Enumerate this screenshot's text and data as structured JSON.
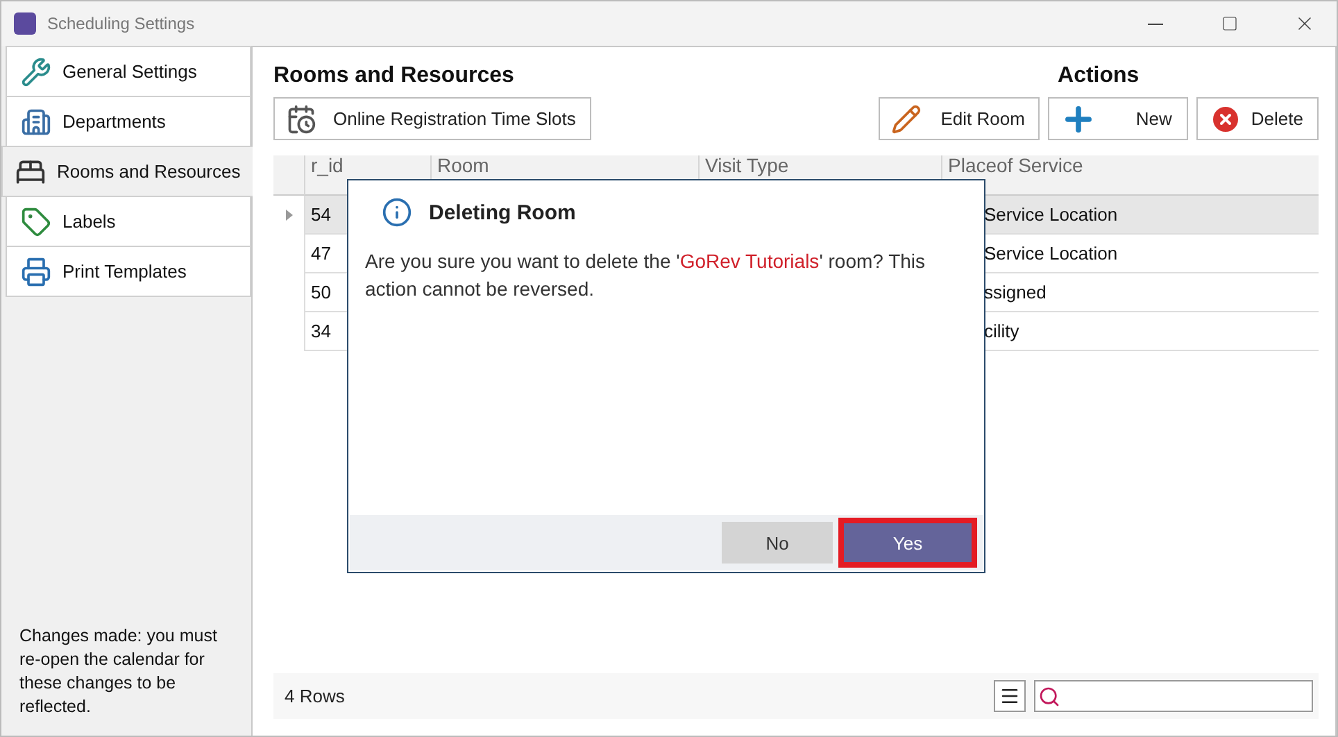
{
  "window": {
    "title": "Scheduling Settings"
  },
  "sidebar": {
    "items": [
      {
        "label": "General Settings",
        "selected": false
      },
      {
        "label": "Departments",
        "selected": false
      },
      {
        "label": "Rooms and Resources",
        "selected": true
      },
      {
        "label": "Labels",
        "selected": false
      },
      {
        "label": "Print Templates",
        "selected": false
      }
    ],
    "note": "Changes made: you must re-open the calendar for these changes to be reflected."
  },
  "section": {
    "title": "Rooms and Resources",
    "toolbar_button": "Online Registration Time Slots"
  },
  "actions": {
    "title": "Actions",
    "buttons": [
      {
        "label": "Edit Room",
        "kind": "edit"
      },
      {
        "label": "New",
        "kind": "new"
      },
      {
        "label": "Delete",
        "kind": "delete"
      }
    ]
  },
  "table": {
    "columns": [
      "r_id",
      "Room",
      "Visit Type",
      "Placeof Service"
    ],
    "rows": [
      {
        "r_id": "54",
        "place_of_service": "Service Location",
        "selected": true
      },
      {
        "r_id": "47",
        "place_of_service": "Service Location",
        "selected": false
      },
      {
        "r_id": "50",
        "place_of_service": "ssigned",
        "selected": false
      },
      {
        "r_id": "34",
        "place_of_service": "cility",
        "selected": false
      }
    ]
  },
  "footer": {
    "row_count": "4 Rows"
  },
  "dialog": {
    "title": "Deleting Room",
    "message": {
      "before": "Are you sure you want to delete the '",
      "highlight": "GoRev Tutorials",
      "after": "' room? This action cannot be reversed."
    },
    "buttons": [
      {
        "label": "No",
        "focused": false
      },
      {
        "label": "Yes",
        "focused": true
      }
    ]
  }
}
